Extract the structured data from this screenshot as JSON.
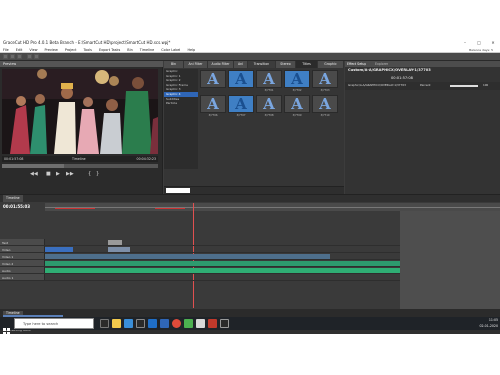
{
  "window": {
    "title": "GraceCut HD Pro 4.0.1 Beta Branch - E:\\SmartCut HD\\project\\SmartCut HD.scs.wpj*",
    "balance_note": "Balance days: 5"
  },
  "menu": [
    "File",
    "Edit",
    "View",
    "Preview",
    "Project",
    "Tools",
    "Export Tasks",
    "Bin",
    "Timeline",
    "Color Label",
    "Help"
  ],
  "preview": {
    "header": "Preview",
    "timecode_left": "00:01:57:08",
    "timecode_center": "Timeline",
    "timecode_right": "00:04:32:23"
  },
  "templates": {
    "tabs": [
      "Bin",
      "Ani Filter",
      "Audio Filter",
      "Anl",
      "Transition",
      "Stereo",
      "Titles",
      "Graphic"
    ],
    "categories": [
      "Graphic",
      "Graphic 1",
      "Graphic 2",
      "Graphic Frame",
      "Graphic 3",
      "Graphic 4",
      "Subtitles",
      "Particle"
    ],
    "row1_caps": [
      "",
      "",
      "3/7701",
      "3/7702",
      "3/7703",
      "3/7704",
      "3/7705"
    ],
    "row2_caps": [
      "3/7706",
      "3/7707",
      "3/7708",
      "3/7709",
      "3/7710",
      "3/7711",
      "3/7712"
    ]
  },
  "effects": {
    "tabs": [
      "Effect Setup",
      "Explorer"
    ],
    "path": "Custom/A-A/GRAPHICX/OVERLAY-1/37703",
    "timecode": "00:01:57:08",
    "item": "Graphic/A-A/GRAPHICX/OVERLAY-1/37703",
    "value_label": "Percent",
    "value": "100"
  },
  "timeline": {
    "header": "Timeline",
    "timecode": "00:01:55:03",
    "tracks": [
      "Text",
      "Video",
      "Video 1",
      "Video 2",
      "Audio",
      "Audio 1"
    ],
    "bottom_tab": "Timeline"
  },
  "status_text": "Auto-saving done",
  "taskbar": {
    "search_placeholder": "Type here to search",
    "time": "11:05",
    "date": "02-01-2020"
  },
  "colors": {
    "accent": "#2f66b7",
    "clip_video": "#2d9a6e",
    "clip_audio": "#2fae74",
    "preview_bg": "#1a1414"
  }
}
